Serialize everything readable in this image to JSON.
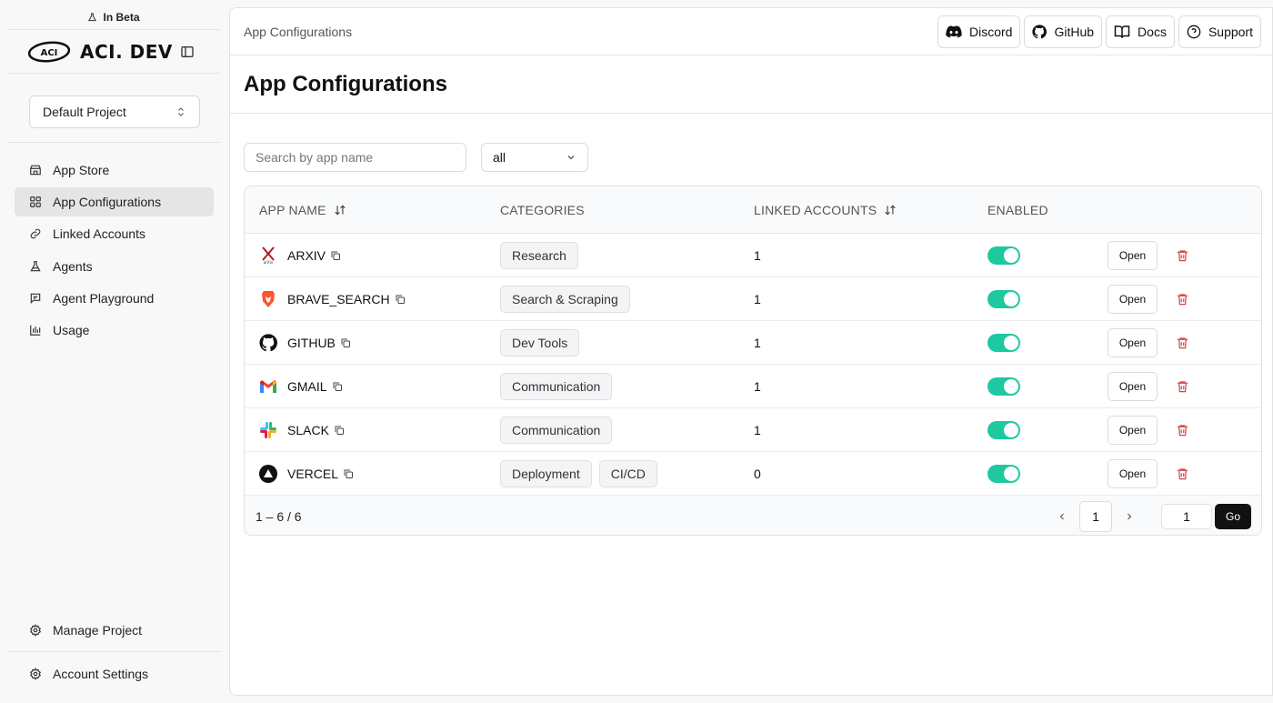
{
  "sidebar": {
    "beta_label": "In Beta",
    "logo_badge": "ACI",
    "logo_text": "ACI. DEV",
    "project": "Default Project",
    "nav": [
      {
        "label": "App Store",
        "icon": "store-icon"
      },
      {
        "label": "App Configurations",
        "icon": "grid-icon",
        "active": true
      },
      {
        "label": "Linked Accounts",
        "icon": "link-icon"
      },
      {
        "label": "Agents",
        "icon": "flask-icon"
      },
      {
        "label": "Agent Playground",
        "icon": "chat-icon"
      },
      {
        "label": "Usage",
        "icon": "bar-chart-icon"
      }
    ],
    "manage_project": "Manage Project",
    "account_settings": "Account Settings"
  },
  "header": {
    "breadcrumb": "App Configurations",
    "links": {
      "discord": "Discord",
      "github": "GitHub",
      "docs": "Docs",
      "support": "Support"
    }
  },
  "page": {
    "title": "App Configurations",
    "search_placeholder": "Search by app name",
    "category_filter": "all"
  },
  "table": {
    "headers": {
      "app_name": "APP NAME",
      "categories": "CATEGORIES",
      "linked_accounts": "LINKED ACCOUNTS",
      "enabled": "ENABLED"
    },
    "open_label": "Open",
    "rows": [
      {
        "name": "ARXIV",
        "icon": "arxiv-icon",
        "categories": [
          "Research"
        ],
        "linked": "1",
        "enabled": true
      },
      {
        "name": "BRAVE_SEARCH",
        "icon": "brave-icon",
        "categories": [
          "Search & Scraping"
        ],
        "linked": "1",
        "enabled": true
      },
      {
        "name": "GITHUB",
        "icon": "github-icon",
        "categories": [
          "Dev Tools"
        ],
        "linked": "1",
        "enabled": true
      },
      {
        "name": "GMAIL",
        "icon": "gmail-icon",
        "categories": [
          "Communication"
        ],
        "linked": "1",
        "enabled": true
      },
      {
        "name": "SLACK",
        "icon": "slack-icon",
        "categories": [
          "Communication"
        ],
        "linked": "1",
        "enabled": true
      },
      {
        "name": "VERCEL",
        "icon": "vercel-icon",
        "categories": [
          "Deployment",
          "CI/CD"
        ],
        "linked": "0",
        "enabled": true
      }
    ]
  },
  "pagination": {
    "count": "1 – 6 / 6",
    "current": "1",
    "goto_value": "1",
    "go_label": "Go"
  },
  "colors": {
    "toggle_on": "#1ec9a2",
    "delete": "#d64545",
    "active_nav": "#e5e5e5"
  }
}
